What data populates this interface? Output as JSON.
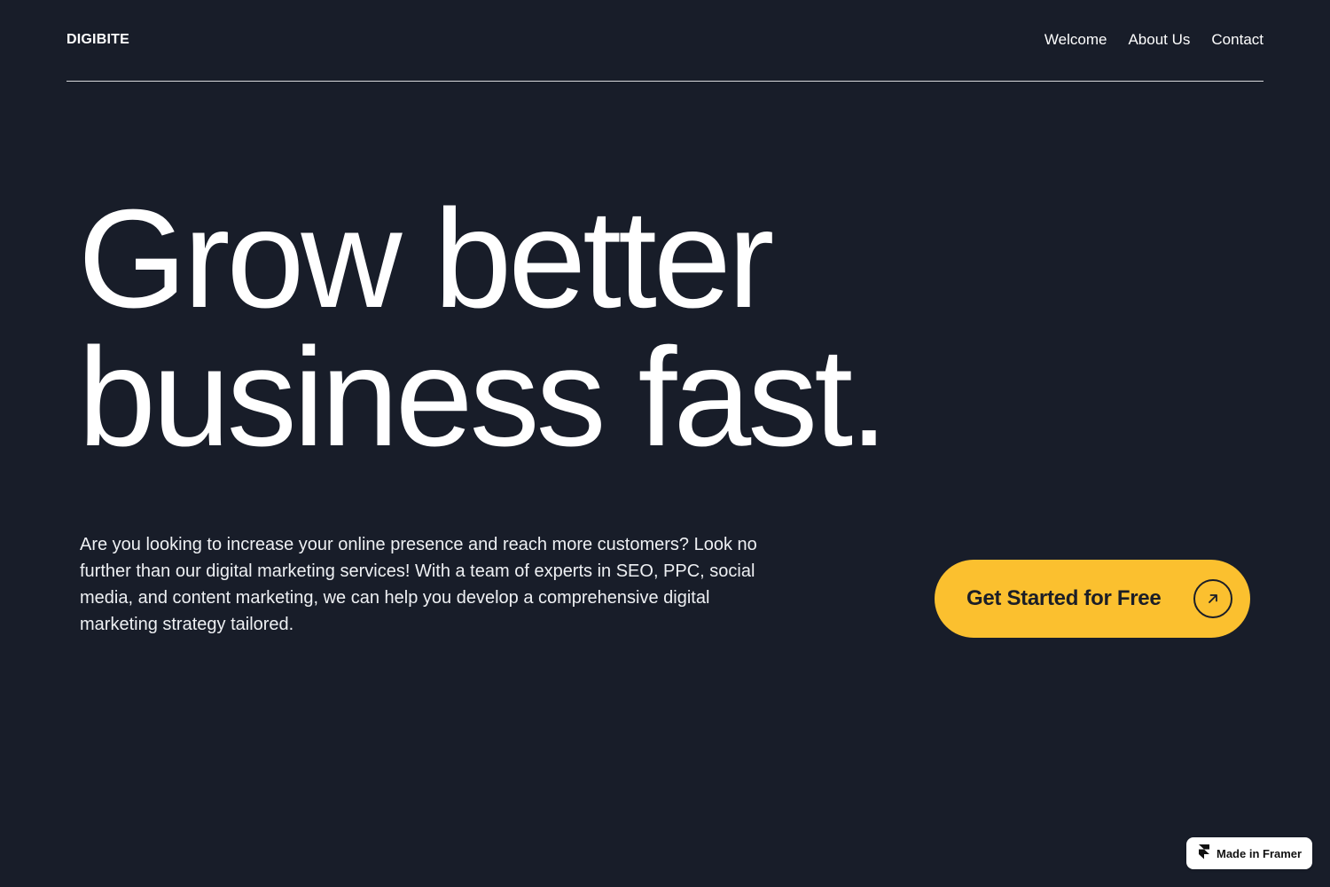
{
  "header": {
    "logo": "DIGIBITE",
    "nav": [
      "Welcome",
      "About Us",
      "Contact"
    ]
  },
  "hero": {
    "headline_line1": "Grow better",
    "headline_line2": "business fast.",
    "intro": "Are you looking to increase your online presence and reach more customers? Look no further than our digital marketing services! With a team of experts in SEO, PPC, social media, and content marketing, we can help you develop a comprehensive digital marketing strategy tailored.",
    "cta_label": "Get Started for Free",
    "cta_icon": "arrow-up-right-icon"
  },
  "badge": {
    "label": "Made in Framer",
    "icon": "framer-logo-icon"
  },
  "colors": {
    "background": "#181d29",
    "accent": "#fbc02f",
    "text": "#ffffff"
  }
}
